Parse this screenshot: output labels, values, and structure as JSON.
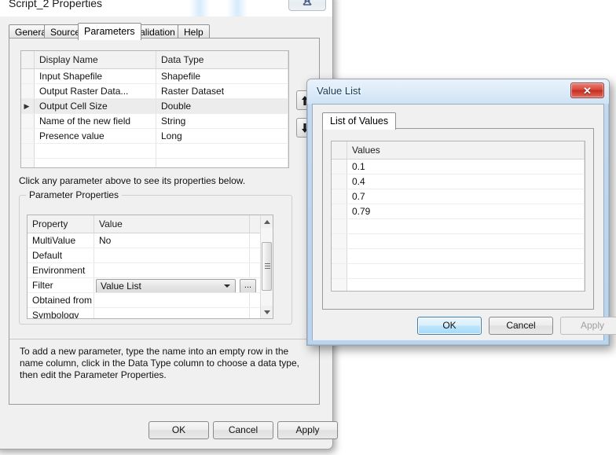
{
  "main_window": {
    "title": "Script_2 Properties",
    "close_icon": "close-x-icon",
    "tabs": [
      {
        "label": "General",
        "selected": false
      },
      {
        "label": "Source",
        "selected": false
      },
      {
        "label": "Parameters",
        "selected": true
      },
      {
        "label": "Validation",
        "selected": false
      },
      {
        "label": "Help",
        "selected": false
      }
    ],
    "parameters_grid": {
      "columns": [
        "Display Name",
        "Data Type"
      ],
      "rows": [
        {
          "display_name": "Input Shapefile",
          "data_type": "Shapefile",
          "current": false
        },
        {
          "display_name": "Output Raster Data...",
          "data_type": "Raster Dataset",
          "current": false
        },
        {
          "display_name": "Output Cell Size",
          "data_type": "Double",
          "current": true
        },
        {
          "display_name": "Name of the new field",
          "data_type": "String",
          "current": false
        },
        {
          "display_name": "Presence value",
          "data_type": "Long",
          "current": false
        },
        {
          "display_name": "",
          "data_type": "",
          "current": false
        },
        {
          "display_name": "",
          "data_type": "",
          "current": false
        },
        {
          "display_name": "",
          "data_type": "",
          "current": false
        }
      ],
      "row_marker": "▶"
    },
    "move_up_button": "arrow-up-icon",
    "move_down_button": "arrow-down-icon",
    "hint_text": "Click any parameter above to see its properties below.",
    "parameter_properties": {
      "legend": "Parameter Properties",
      "columns": [
        "Property",
        "Value"
      ],
      "rows": [
        {
          "property": "MultiValue",
          "value": "No",
          "control": "text"
        },
        {
          "property": "Default",
          "value": "",
          "control": "text"
        },
        {
          "property": "Environment",
          "value": "",
          "control": "text"
        },
        {
          "property": "Filter",
          "value": "Value List",
          "control": "combo"
        },
        {
          "property": "Obtained from",
          "value": "",
          "control": "text"
        },
        {
          "property": "Symbology",
          "value": "",
          "control": "text"
        },
        {
          "property": "",
          "value": "",
          "control": "text"
        }
      ],
      "browse_button_label": "...",
      "combo_arrow_icon": "chevron-down-icon"
    },
    "description": "To add a new parameter, type the name into an empty row in the name column, click in the Data Type column to choose a data type, then edit the Parameter Properties.",
    "buttons": {
      "ok": "OK",
      "cancel": "Cancel",
      "apply": "Apply"
    }
  },
  "value_list_window": {
    "title": "Value List",
    "close_icon": "close-x-icon",
    "close_glyph": "✕",
    "tabs": [
      {
        "label": "List of Values",
        "selected": true
      }
    ],
    "values_grid": {
      "columns": [
        "Values"
      ],
      "rows": [
        "0.1",
        "0.4",
        "0.7",
        "0.79",
        "",
        "",
        "",
        "",
        "",
        "",
        ""
      ]
    },
    "buttons": {
      "ok": "OK",
      "cancel": "Cancel",
      "apply": "Apply",
      "apply_disabled": true
    }
  },
  "colors": {
    "dialog_face": "#f0f0f0",
    "aero_blue": "#cfe2f4",
    "close_red": "#d8483a",
    "default_button_blue": "#3c7fb1",
    "disabled_text": "#a0a0a0"
  }
}
